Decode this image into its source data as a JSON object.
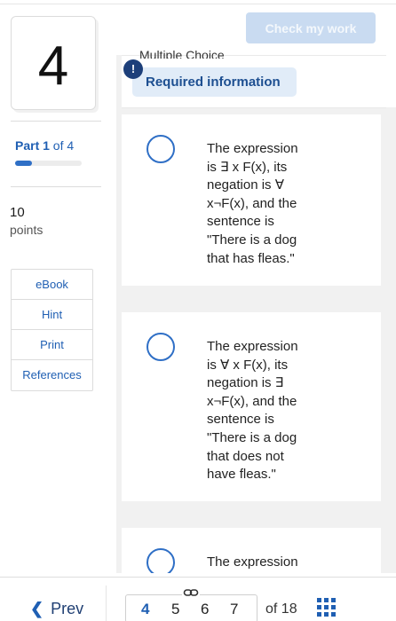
{
  "question": {
    "number": "4"
  },
  "part": {
    "label_bold": "Part 1",
    "label_rest": " of 4",
    "progress_fraction": 0.25
  },
  "points": {
    "value": "10",
    "label": "points"
  },
  "tools": [
    "eBook",
    "Hint",
    "Print",
    "References"
  ],
  "header": {
    "check_button": "Check my work",
    "question_type": "Multiple Choice",
    "required_info": "Required information",
    "alert_glyph": "!"
  },
  "options": [
    {
      "lines": [
        "The expression",
        "is ∃ x F(x), its",
        "negation is ∀",
        "x¬F(x), and the",
        "sentence is",
        "\"There is a dog",
        "that has fleas.\""
      ]
    },
    {
      "lines": [
        "The expression",
        "is ∀ x F(x), its",
        "negation is ∃",
        "x¬F(x), and the",
        "sentence is",
        "\"There is a dog",
        "that does not",
        "have fleas.\""
      ]
    },
    {
      "lines": [
        "The expression"
      ]
    }
  ],
  "nav": {
    "prev_label": "Prev",
    "pages": [
      "4",
      "5",
      "6",
      "7"
    ],
    "current_page": "4",
    "of_total": "of 18"
  },
  "icons": {
    "prev": "chevron-left-icon",
    "link": "chain-link-icon",
    "grid": "grid-icon",
    "alert": "alert-icon"
  },
  "colors": {
    "accent": "#2f6fc6",
    "dark_accent": "#1d3f7a",
    "badge_bg": "#e1ecf8",
    "button_disabled": "#c9dbf1"
  }
}
